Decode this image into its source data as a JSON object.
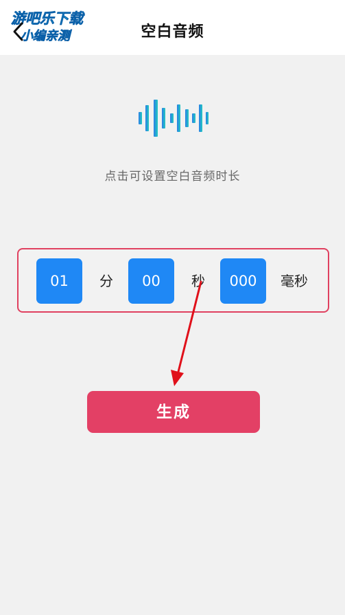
{
  "header": {
    "title": "空白音频",
    "back_icon": "chevron-left-icon",
    "watermark_line1": "游吧乐下载",
    "watermark_line2": "小编亲测"
  },
  "main": {
    "wave_icon": "audio-waveform-icon",
    "hint": "点击可设置空白音频时长"
  },
  "duration": {
    "minutes": "01",
    "minutes_unit": "分",
    "seconds": "00",
    "seconds_unit": "秒",
    "milliseconds": "000",
    "milliseconds_unit": "毫秒"
  },
  "actions": {
    "generate_label": "生成"
  },
  "colors": {
    "accent_blue": "#1f88f5",
    "accent_red": "#e34065",
    "annotation_arrow": "#e0101a"
  }
}
